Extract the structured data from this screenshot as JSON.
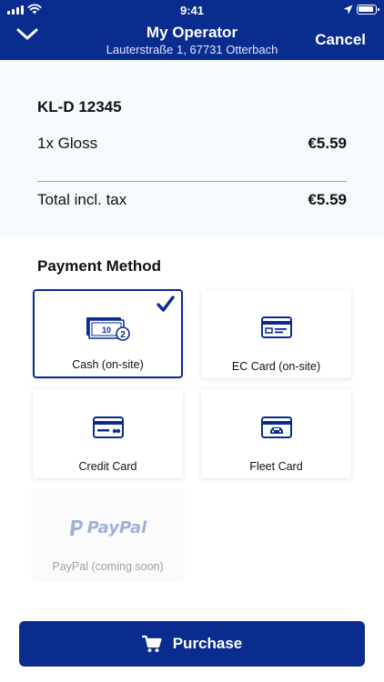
{
  "status_bar": {
    "time": "9:41"
  },
  "header": {
    "title": "My Operator",
    "subtitle": "Lauterstraße 1, 67731 Otterbach",
    "cancel_label": "Cancel"
  },
  "order": {
    "plate": "KL-D 12345",
    "items": [
      {
        "label": "1x Gloss",
        "price": "€5.59"
      }
    ],
    "total_label": "Total incl. tax",
    "total_value": "€5.59"
  },
  "payment": {
    "title": "Payment Method",
    "methods": [
      {
        "label": "Cash (on-site)",
        "icon": "cash-icon",
        "selected": true
      },
      {
        "label": "EC Card (on-site)",
        "icon": "ec-card-icon",
        "selected": false
      },
      {
        "label": "Credit Card",
        "icon": "credit-card-icon",
        "selected": false
      },
      {
        "label": "Fleet Card",
        "icon": "fleet-card-icon",
        "selected": false
      },
      {
        "label": "PayPal (coming soon)",
        "icon": "paypal-logo",
        "selected": false,
        "disabled": true
      }
    ],
    "paypal_logo_text": "PayPal",
    "cash_note_value": "10",
    "cash_coin_value": "2"
  },
  "purchase": {
    "label": "Purchase"
  },
  "colors": {
    "primary": "#0a2c8f",
    "background": "#f6fafd"
  }
}
